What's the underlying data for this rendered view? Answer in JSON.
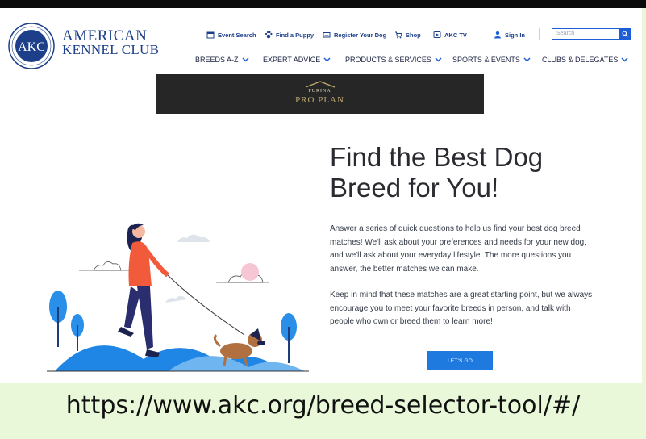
{
  "header": {
    "brand_line1": "AMERICAN",
    "brand_line2": "KENNEL CLUB",
    "logo_text": "AKC",
    "utility_links": [
      {
        "label": "Event Search",
        "icon": "calendar-icon"
      },
      {
        "label": "Find a Puppy",
        "icon": "paw-icon"
      },
      {
        "label": "Register Your Dog",
        "icon": "card-icon"
      },
      {
        "label": "Shop",
        "icon": "cart-icon"
      },
      {
        "label": "AKC TV",
        "icon": "play-icon"
      },
      {
        "label": "Sign In",
        "icon": "user-icon"
      }
    ],
    "search_placeholder": "Search",
    "main_nav": [
      "BREEDS A-Z",
      "EXPERT ADVICE",
      "PRODUCTS & SERVICES",
      "SPORTS & EVENTS",
      "CLUBS & DELEGATES"
    ]
  },
  "ad": {
    "brand_small": "PURINA",
    "brand_large": "PRO PLAN"
  },
  "content": {
    "headline_line1": "Find the Best Dog",
    "headline_line2": "Breed for You!",
    "paragraph1": "Answer a series of quick questions to help us find your best dog breed matches! We'll ask about your preferences and needs for your new dog, and we'll ask about your everyday lifestyle. The more questions you answer, the better matches we can make.",
    "paragraph2": "Keep in mind that these matches are a great starting point, but we always encourage you to meet your favorite breeds in person, and talk with people who own or breed them to learn more!",
    "cta_label": "LET'S GO"
  },
  "caption": {
    "url": "https://www.akc.org/breed-selector-tool/#/"
  },
  "colors": {
    "brand_blue": "#1d3f8a",
    "accent_blue": "#1f7ae0",
    "slide_background": "#e8f8d8"
  }
}
